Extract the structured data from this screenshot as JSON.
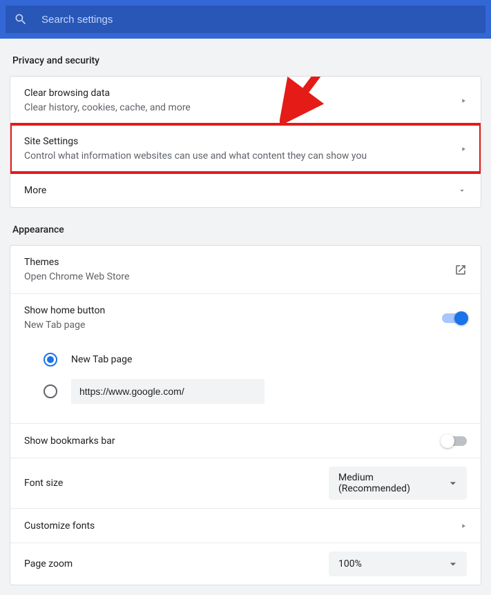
{
  "search": {
    "placeholder": "Search settings"
  },
  "sections": {
    "privacy": {
      "title": "Privacy and security",
      "clear_data": {
        "title": "Clear browsing data",
        "sub": "Clear history, cookies, cache, and more"
      },
      "site_settings": {
        "title": "Site Settings",
        "sub": "Control what information websites can use and what content they can show you"
      },
      "more": {
        "title": "More"
      }
    },
    "appearance": {
      "title": "Appearance",
      "themes": {
        "title": "Themes",
        "sub": "Open Chrome Web Store"
      },
      "home_button": {
        "title": "Show home button",
        "sub": "New Tab page"
      },
      "home_radio": {
        "newtab": "New Tab page",
        "custom_url": "https://www.google.com/"
      },
      "bookmarks_bar": {
        "title": "Show bookmarks bar"
      },
      "font_size": {
        "title": "Font size",
        "value": "Medium (Recommended)"
      },
      "customize_fonts": {
        "title": "Customize fonts"
      },
      "page_zoom": {
        "title": "Page zoom",
        "value": "100%"
      }
    }
  }
}
